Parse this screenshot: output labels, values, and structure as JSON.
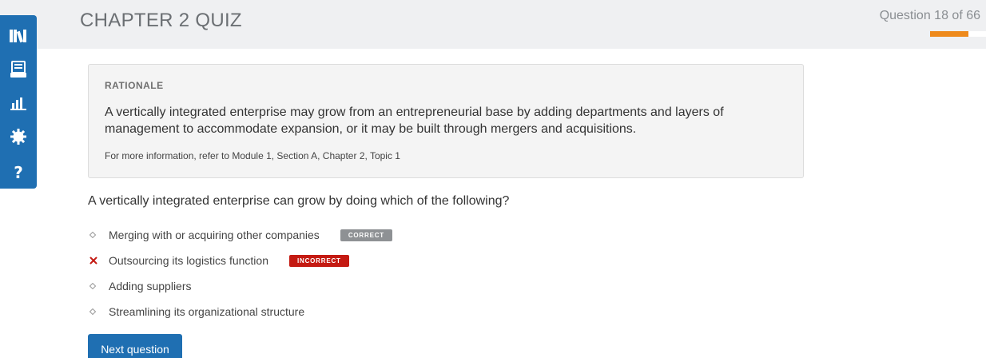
{
  "header": {
    "title": "CHAPTER 2 QUIZ",
    "progress_label": "Question 18 of 66",
    "progress": {
      "current": 18,
      "total": 66,
      "fraction": 0.68
    }
  },
  "sidebar": {
    "items": [
      {
        "icon": "library-icon"
      },
      {
        "icon": "notebook-icon"
      },
      {
        "icon": "bar-chart-icon"
      },
      {
        "icon": "gear-icon"
      },
      {
        "icon": "help-icon",
        "glyph": "?"
      }
    ]
  },
  "rationale": {
    "heading": "RATIONALE",
    "body": "A vertically integrated enterprise may grow from an entrepreneurial base by adding departments and layers of management to accommodate expansion, or it may be built through mergers and acquisitions.",
    "reference": "For more information, refer to Module 1, Section A, Chapter 2, Topic 1"
  },
  "question": {
    "text": "A vertically integrated enterprise can grow by doing which of the following?",
    "answers": [
      {
        "text": "Merging with or acquiring other companies",
        "badge": "CORRECT",
        "marker": "diamond"
      },
      {
        "text": "Outsourcing its logistics function",
        "badge": "INCORRECT",
        "marker": "x"
      },
      {
        "text": "Adding suppliers",
        "marker": "diamond"
      },
      {
        "text": "Streamlining its organizational structure",
        "marker": "diamond"
      }
    ]
  },
  "actions": {
    "next_label": "Next question"
  },
  "colors": {
    "brand_blue": "#1f6fb2",
    "progress_orange": "#ee8a1c",
    "incorrect_red": "#c41a12",
    "correct_gray": "#8e9194"
  }
}
